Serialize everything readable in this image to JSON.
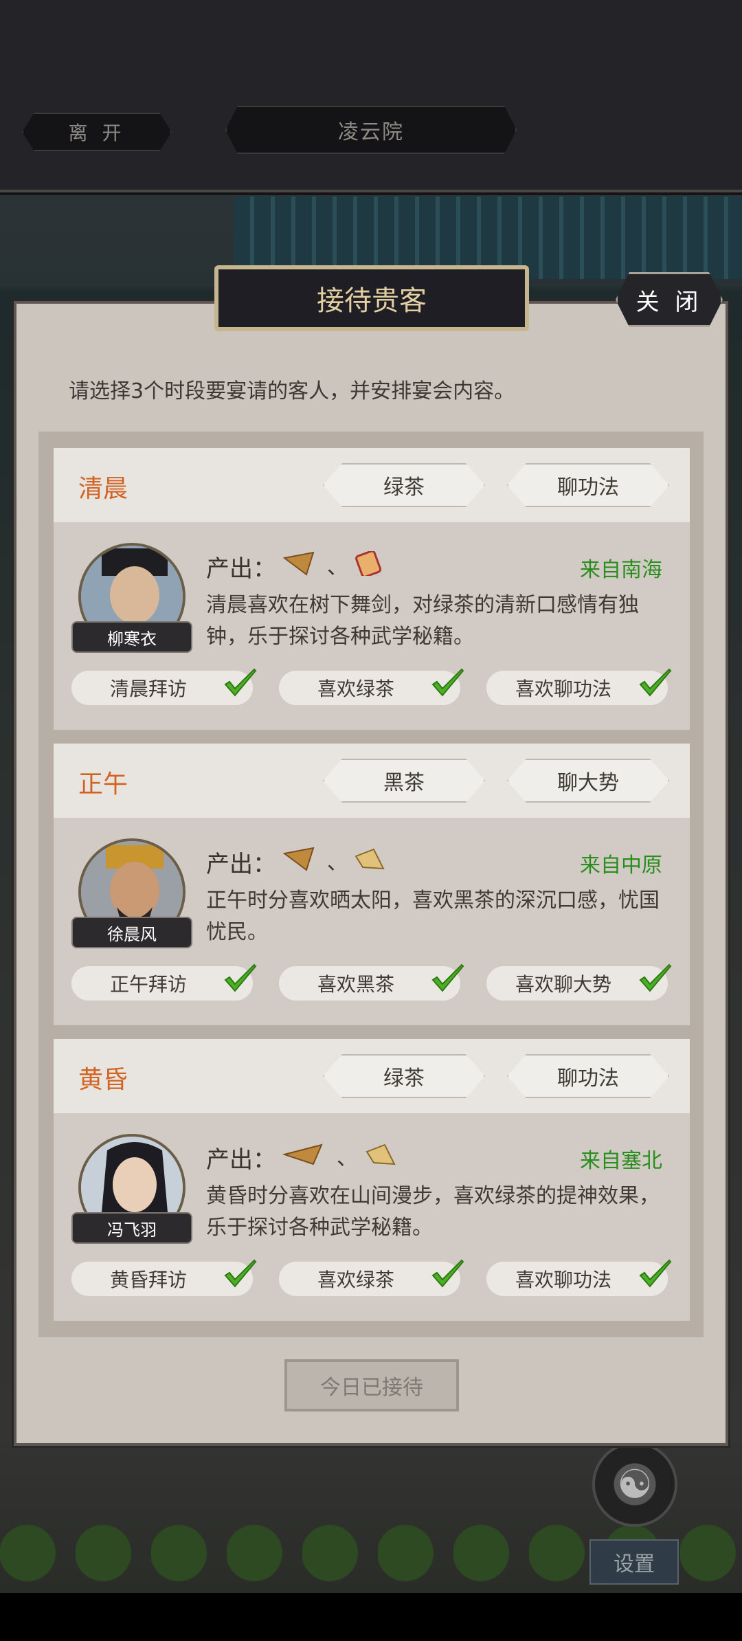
{
  "topbar": {
    "leave_label": "离 开",
    "location_label": "凌云院"
  },
  "dialog": {
    "title": "接待贵客",
    "close_label": "关 闭",
    "instruction": "请选择3个时段要宴请的客人，并安排宴会内容。",
    "output_label": "产出：",
    "item_separator": "、",
    "today_button": "今日已接待"
  },
  "guests": [
    {
      "period": "清晨",
      "tea": "绿茶",
      "topic": "聊功法",
      "name": "柳寒衣",
      "origin": "来自南海",
      "description": "清晨喜欢在树下舞剑，对绿茶的清新口感情有独钟，乐于探讨各种武学秘籍。",
      "tags": [
        "清晨拜访",
        "喜欢绿茶",
        "喜欢聊功法"
      ]
    },
    {
      "period": "正午",
      "tea": "黑茶",
      "topic": "聊大势",
      "name": "徐晨风",
      "origin": "来自中原",
      "description": "正午时分喜欢晒太阳，喜欢黑茶的深沉口感，忧国忧民。",
      "tags": [
        "正午拜访",
        "喜欢黑茶",
        "喜欢聊大势"
      ]
    },
    {
      "period": "黄昏",
      "tea": "绿茶",
      "topic": "聊功法",
      "name": "冯飞羽",
      "origin": "来自塞北",
      "description": "黄昏时分喜欢在山间漫步，喜欢绿茶的提神效果，乐于探讨各种武学秘籍。",
      "tags": [
        "黄昏拜访",
        "喜欢绿茶",
        "喜欢聊功法"
      ]
    }
  ],
  "side": {
    "taiji_icon": "☯",
    "settings_label": "设置"
  },
  "colors": {
    "period": "#d26322",
    "origin": "#2a8e1e",
    "check": "#4caf26",
    "title_text": "#e2cfa2"
  }
}
